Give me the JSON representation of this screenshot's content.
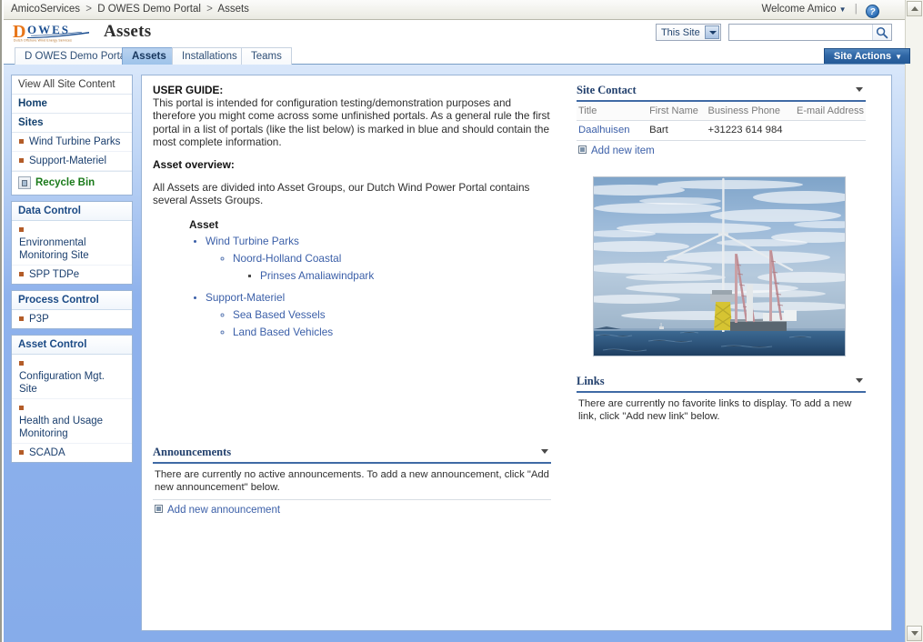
{
  "breadcrumb": {
    "items": [
      "AmicoServices",
      "D OWES Demo Portal",
      "Assets"
    ],
    "separator": ">"
  },
  "topbar": {
    "welcome": "Welcome Amico",
    "welcome_caret": "▼",
    "separator": "|",
    "help_icon": "help-icon",
    "help_glyph": "?"
  },
  "header": {
    "logo_d": "D",
    "logo_owes": "OWES",
    "logo_tagline": "Dutch Offshore Wind Energy Services",
    "site_title": "Assets"
  },
  "search": {
    "scope_label": "This Site",
    "scope_caret": "▼",
    "value": "",
    "placeholder": "",
    "go_icon": "search-icon"
  },
  "site_actions": {
    "label": "Site Actions",
    "caret": "▼"
  },
  "tabs": [
    {
      "label": "D OWES Demo Portal",
      "selected": false
    },
    {
      "label": "Assets",
      "selected": true
    },
    {
      "label": "Installations",
      "selected": false
    },
    {
      "label": "Teams",
      "selected": false
    }
  ],
  "sidebar": {
    "quicklaunch": {
      "view_all": "View All Site Content",
      "home": "Home",
      "sites_header": "Sites",
      "sites": [
        "Wind Turbine Parks",
        "Support-Materiel"
      ],
      "recycle_bin": "Recycle Bin",
      "recycle_bin_icon": "recycle-bin-icon"
    },
    "groups": [
      {
        "title": "Data Control",
        "items": [
          "Environmental Monitoring Site",
          "SPP TDPe"
        ]
      },
      {
        "title": "Process Control",
        "items": [
          "P3P"
        ]
      },
      {
        "title": "Asset Control",
        "items": [
          "Configuration Mgt. Site",
          "Health and Usage Monitoring",
          "SCADA"
        ]
      }
    ]
  },
  "content": {
    "userguide": {
      "heading": "USER GUIDE:",
      "paragraph": "This portal is intended for configuration testing/demonstration purposes and therefore you might come across some unfinished portals. As a general rule the first portal in a list of portals (like the list below) is marked in blue and should contain the most complete information.",
      "overview_heading": "Asset overview:",
      "overview_paragraph": "All Assets are divided into Asset Groups, our Dutch Wind Power Portal contains several Assets Groups."
    },
    "asset_tree": {
      "title": "Asset",
      "nodes": [
        {
          "label": "Wind Turbine Parks",
          "children": [
            {
              "label": "Noord-Holland Coastal",
              "children": [
                {
                  "label": "Prinses Amaliawindpark",
                  "children": []
                }
              ]
            }
          ]
        },
        {
          "label": "Support-Materiel",
          "children": [
            {
              "label": "Sea Based Vessels",
              "children": []
            },
            {
              "label": "Land Based Vehicles",
              "children": []
            }
          ]
        }
      ]
    },
    "announcements": {
      "title": "Announcements",
      "empty_text": "There are currently no active announcements. To add a new announcement, click \"Add new announcement\" below.",
      "add_label": "Add new announcement"
    },
    "site_contact": {
      "title": "Site Contact",
      "columns": [
        "Title",
        "First Name",
        "Business Phone",
        "E-mail Address"
      ],
      "rows": [
        {
          "title": "Daalhuisen",
          "first_name": "Bart",
          "business_phone": "+31223 614 984",
          "email": ""
        }
      ],
      "add_label": "Add new item"
    },
    "photo": {
      "alt": "Offshore wind turbine installation with jack-up crane vessel at sea"
    },
    "links": {
      "title": "Links",
      "empty_text": "There are currently no favorite links to display. To add a new link, click \"Add new link\" below."
    }
  },
  "colors": {
    "body_blue": "#86acea",
    "accent_blue": "#2f66a5",
    "link_blue": "#3b5fa8",
    "logo_orange": "#e8761a",
    "logo_blue": "#1c4f91",
    "recycle_green": "#1a7a1a",
    "bullet_brown": "#b35c28"
  }
}
